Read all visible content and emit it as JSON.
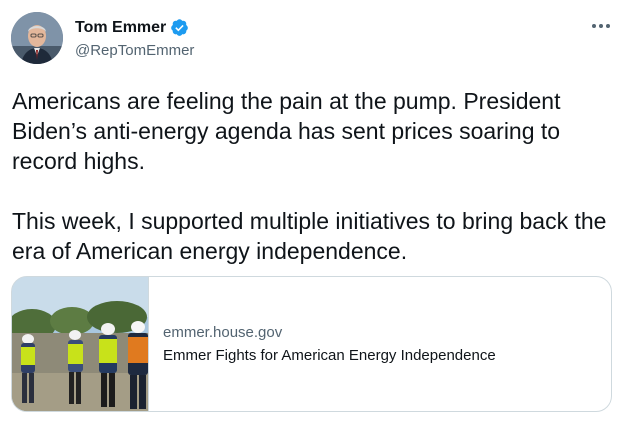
{
  "author": {
    "display_name": "Tom Emmer",
    "handle": "@RepTomEmmer",
    "verified": true
  },
  "tweet": {
    "paragraphs": [
      "Americans are feeling the pain at the pump. President Biden’s anti-energy agenda has sent prices soaring to record highs.",
      "This week, I supported multiple initiatives to bring back the era of American energy independence."
    ]
  },
  "link_card": {
    "domain": "emmer.house.gov",
    "title": "Emmer Fights for American Energy Independence"
  },
  "icons": {
    "verified": "verified-badge-icon",
    "more": "more-options-icon"
  },
  "colors": {
    "verified_blue": "#1d9bf0",
    "text_primary": "#0f1419",
    "text_secondary": "#536471",
    "border": "#cfd9de",
    "safety_vest": "#c8e21a"
  }
}
